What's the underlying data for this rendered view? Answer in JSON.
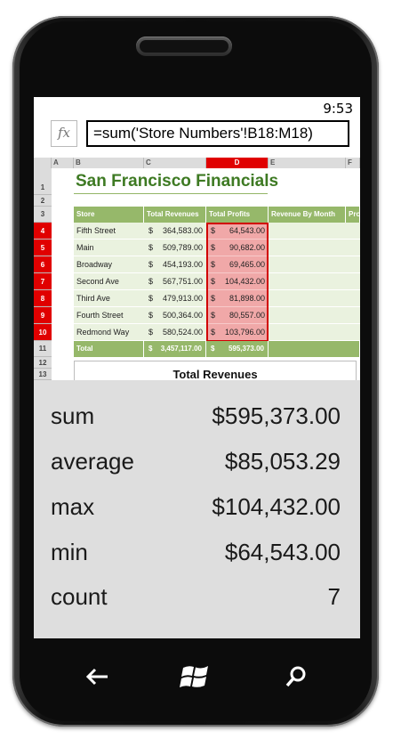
{
  "status": {
    "time": "9:53"
  },
  "formula_bar": {
    "fx_label": "fx",
    "formula": "=sum('Store Numbers'!B18:M18)"
  },
  "sheet": {
    "columns": [
      "A",
      "B",
      "C",
      "D",
      "E",
      "F"
    ],
    "rows": [
      "1",
      "2",
      "3",
      "4",
      "5",
      "6",
      "7",
      "8",
      "9",
      "10",
      "11",
      "12",
      "13"
    ],
    "title": "San Francisco Financials",
    "headers": [
      "Store",
      "Total Revenues",
      "Total Profits",
      "Revenue By Month",
      "Pro"
    ],
    "currency": "$",
    "data": [
      {
        "store": "Fifth Street",
        "revenue": "364,583.00",
        "profit": "64,543.00"
      },
      {
        "store": "Main",
        "revenue": "509,789.00",
        "profit": "90,682.00"
      },
      {
        "store": "Broadway",
        "revenue": "454,193.00",
        "profit": "69,465.00"
      },
      {
        "store": "Second Ave",
        "revenue": "567,751.00",
        "profit": "104,432.00"
      },
      {
        "store": "Third Ave",
        "revenue": "479,913.00",
        "profit": "81,898.00"
      },
      {
        "store": "Fourth Street",
        "revenue": "500,364.00",
        "profit": "80,557.00"
      },
      {
        "store": "Redmond Way",
        "revenue": "580,524.00",
        "profit": "103,796.00"
      }
    ],
    "total": {
      "label": "Total",
      "revenue": "3,457,117.00",
      "profit": "595,373.00"
    },
    "chart_title": "Total Revenues"
  },
  "summary": [
    {
      "label": "sum",
      "value": "$595,373.00"
    },
    {
      "label": "average",
      "value": "$85,053.29"
    },
    {
      "label": "max",
      "value": "$104,432.00"
    },
    {
      "label": "min",
      "value": "$64,543.00"
    },
    {
      "label": "count",
      "value": "7"
    }
  ],
  "colors": {
    "accent_green": "#96b86a",
    "title_green": "#3e7a23",
    "selection_red": "#e00000",
    "selected_fill": "#f0a8a8"
  },
  "nav": {
    "back": "back-arrow-icon",
    "start": "windows-logo-icon",
    "search": "search-icon"
  }
}
